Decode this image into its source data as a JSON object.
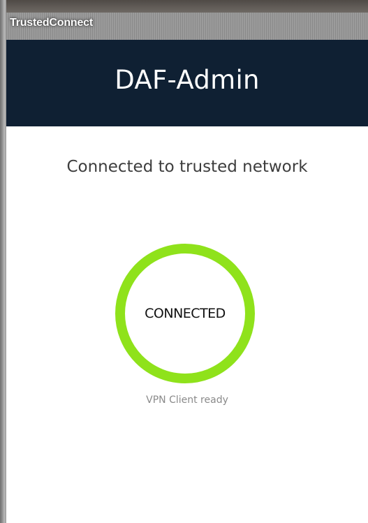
{
  "window": {
    "title": "TrustedConnect"
  },
  "header": {
    "title": "DAF-Admin",
    "background_color": "#0f2033"
  },
  "main": {
    "network_message": "Connected to trusted network",
    "status": {
      "label": "CONNECTED",
      "ring_color": "#8fe21b",
      "subtext": "VPN Client ready"
    }
  }
}
